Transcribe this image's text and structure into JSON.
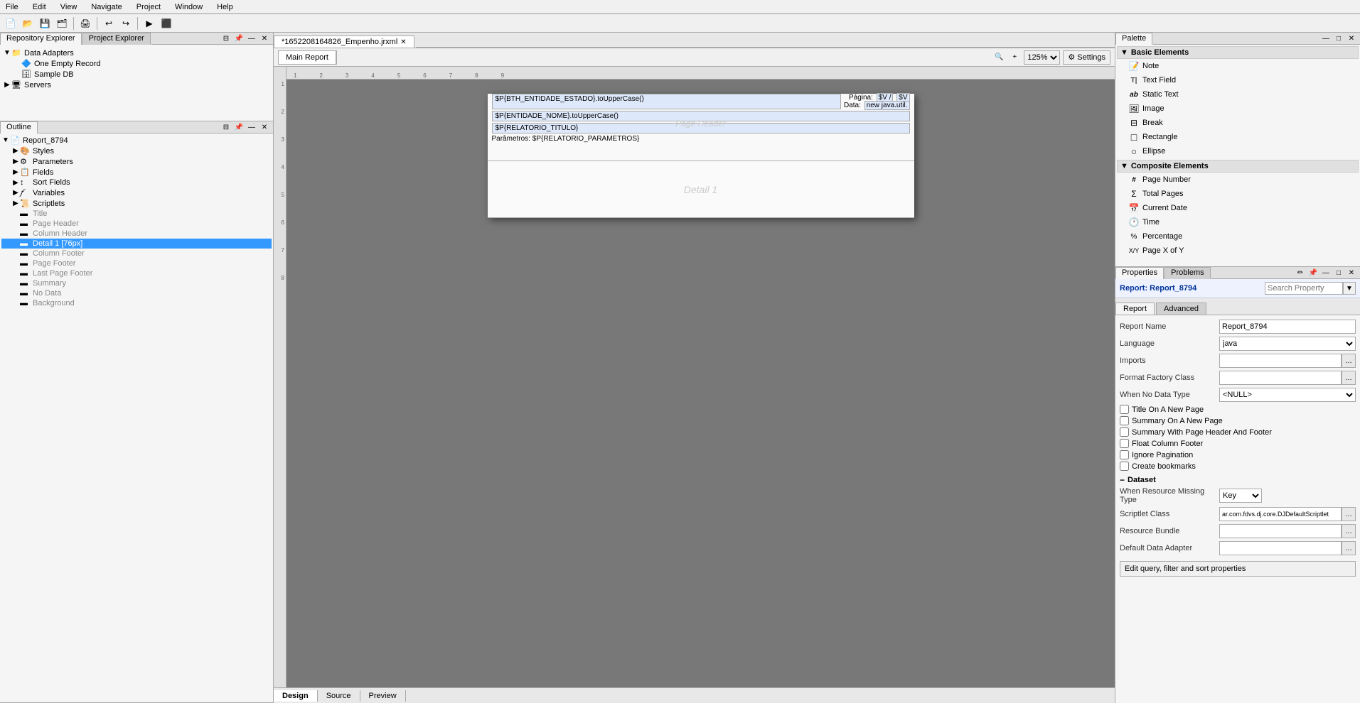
{
  "menubar": {
    "items": [
      "File",
      "Edit",
      "View",
      "Navigate",
      "Project",
      "Window",
      "Help"
    ]
  },
  "repo_explorer": {
    "title": "Repository Explorer",
    "tab": "Repository Explorer",
    "tab2": "Project Explorer",
    "items": [
      {
        "label": "Data Adapters",
        "type": "folder",
        "indent": 0
      },
      {
        "label": "One Empty Record",
        "type": "item",
        "indent": 1
      },
      {
        "label": "Sample DB",
        "type": "item",
        "indent": 1
      },
      {
        "label": "Servers",
        "type": "folder",
        "indent": 0
      }
    ]
  },
  "outline": {
    "title": "Outline",
    "items": [
      {
        "label": "Report_8794",
        "type": "report",
        "indent": 0,
        "expanded": true
      },
      {
        "label": "Styles",
        "type": "folder",
        "indent": 1
      },
      {
        "label": "Parameters",
        "type": "folder",
        "indent": 1
      },
      {
        "label": "Fields",
        "type": "folder",
        "indent": 1
      },
      {
        "label": "Sort Fields",
        "type": "folder",
        "indent": 1
      },
      {
        "label": "Variables",
        "type": "folder",
        "indent": 1
      },
      {
        "label": "Scriptlets",
        "type": "folder",
        "indent": 1
      },
      {
        "label": "Title",
        "type": "section",
        "indent": 1
      },
      {
        "label": "Page Header",
        "type": "section",
        "indent": 1
      },
      {
        "label": "Column Header",
        "type": "section",
        "indent": 1
      },
      {
        "label": "Detail 1 [76px]",
        "type": "section",
        "indent": 1,
        "selected": true
      },
      {
        "label": "Column Footer",
        "type": "section",
        "indent": 1
      },
      {
        "label": "Page Footer",
        "type": "section",
        "indent": 1
      },
      {
        "label": "Last Page Footer",
        "type": "section",
        "indent": 1
      },
      {
        "label": "Summary",
        "type": "section",
        "indent": 1
      },
      {
        "label": "No Data",
        "type": "section",
        "indent": 1
      },
      {
        "label": "Background",
        "type": "section",
        "indent": 1
      }
    ]
  },
  "editor": {
    "tab_label": "*1652208164826_Empenho.jrxml",
    "main_report_tab": "Main Report",
    "zoom": "125%",
    "settings_label": "Settings",
    "canvas": {
      "page_header": {
        "field1": "$P{BTH_ENTIDADE_ESTADO}.toUpperCase()",
        "field2": "$P{ENTIDADE_NOME}.toUpperCase()",
        "field3": "$P{RELATORIO_TITULO}",
        "page_label": "Página:",
        "page_value": "$V /",
        "page_total": "$V",
        "data_label": "Data:",
        "data_value": "new java.util.",
        "params_label": "Parâmetros: $P{RELATORIO_PARAMETROS}",
        "section_name": "Page Header"
      },
      "detail": {
        "label": "Detail 1",
        "section_name": "Detail 1"
      }
    }
  },
  "palette": {
    "title": "Palette",
    "basic_elements": {
      "header": "Basic Elements",
      "items": [
        {
          "label": "Note",
          "icon": "📝"
        },
        {
          "label": "Text Field",
          "icon": "T"
        },
        {
          "label": "Static Text",
          "icon": "A"
        },
        {
          "label": "Image",
          "icon": "🖼"
        },
        {
          "label": "Break",
          "icon": "⊟"
        },
        {
          "label": "Rectangle",
          "icon": "□"
        },
        {
          "label": "Ellipse",
          "icon": "○"
        }
      ]
    },
    "composite_elements": {
      "header": "Composite Elements",
      "items": [
        {
          "label": "Page Number",
          "icon": "#"
        },
        {
          "label": "Total Pages",
          "icon": "Σ"
        },
        {
          "label": "Current Date",
          "icon": "📅"
        },
        {
          "label": "Time",
          "icon": "🕐"
        },
        {
          "label": "Percentage",
          "icon": "%"
        },
        {
          "label": "Page X of Y",
          "icon": "X/Y"
        }
      ]
    }
  },
  "properties": {
    "title": "Properties",
    "tab_problems": "Problems",
    "report_title": "Report: Report_8794",
    "search_placeholder": "Search Property",
    "tab_report": "Report",
    "tab_advanced": "Advanced",
    "fields": {
      "report_name_label": "Report Name",
      "report_name_value": "Report_8794",
      "language_label": "Language",
      "language_value": "java",
      "imports_label": "Imports",
      "format_factory_label": "Format Factory Class",
      "when_no_data_label": "When No Data Type",
      "when_no_data_value": "<NULL>",
      "title_on_new_page": "Title On A New Page",
      "summary_on_new_page": "Summary On A New Page",
      "summary_with_header": "Summary With Page Header And Footer",
      "float_column_footer": "Float Column Footer",
      "ignore_pagination": "Ignore Pagination",
      "create_bookmarks": "Create bookmarks"
    },
    "dataset_section": "Dataset",
    "dataset_fields": {
      "when_resource_missing_label": "When Resource Missing Type",
      "when_resource_missing_value": "Key",
      "scriptlet_class_label": "Scriptlet Class",
      "scriptlet_class_value": "ar.com.fdvs.dj.core.DJDefaultScriptlet",
      "resource_bundle_label": "Resource Bundle",
      "default_data_adapter_label": "Default Data Adapter"
    },
    "bottom_button": "Edit query, filter and sort properties"
  },
  "bottom_tabs": {
    "design": "Design",
    "source": "Source",
    "preview": "Preview"
  }
}
